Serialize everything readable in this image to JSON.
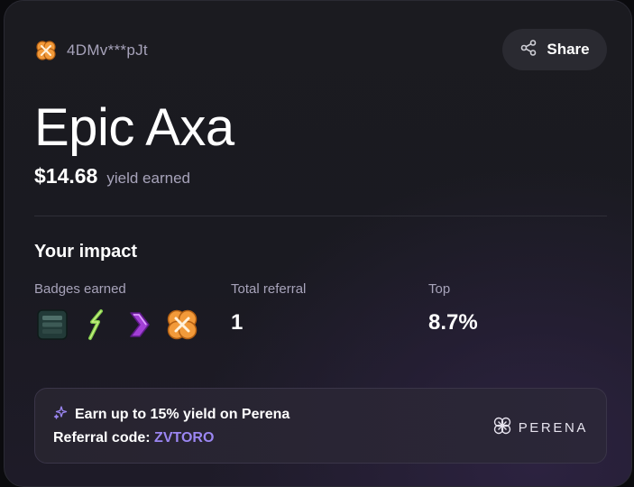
{
  "user": {
    "handle": "4DMv***pJt",
    "avatar_icon": "orange-flower-badge-icon"
  },
  "share": {
    "label": "Share",
    "icon": "share-icon"
  },
  "profile": {
    "name": "Epic Axa",
    "yield_amount": "$14.68",
    "yield_label": "yield earned"
  },
  "impact": {
    "title": "Your impact",
    "badges_label": "Badges earned",
    "badges": [
      "stack-badge-icon",
      "green-lightning-badge-icon",
      "purple-chevron-badge-icon",
      "orange-flower-badge-icon"
    ],
    "referral_label": "Total referral",
    "referral_value": "1",
    "top_label": "Top",
    "top_value": "8.7%"
  },
  "promo": {
    "headline": "Earn up to 15% yield on Perena",
    "code_label": "Referral code: ",
    "code": "ZVTORO",
    "brand": "PERENA",
    "sparkle_icon": "sparkle-icon",
    "brand_icon": "perena-logo-icon"
  },
  "colors": {
    "accent": "#9b86f2",
    "muted_text": "#a7a3ba",
    "background": "#1b1b20"
  }
}
